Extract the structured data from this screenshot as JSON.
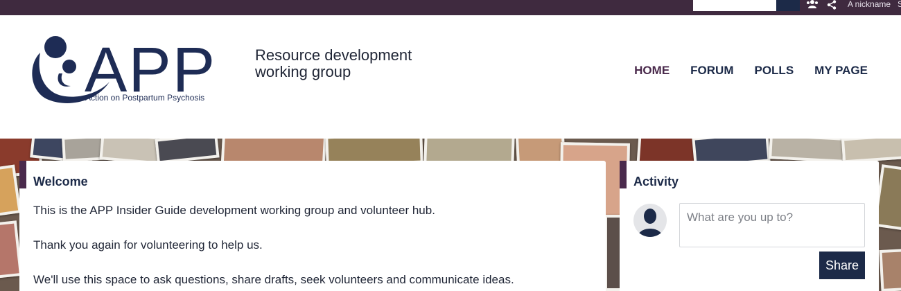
{
  "topbar": {
    "nickname": "A nickname",
    "cut_text": "S",
    "icons": {
      "people": "people-icon",
      "share": "share-icon"
    }
  },
  "header": {
    "logo_text": "APP",
    "logo_subtitle": "Action on Postpartum Psychosis",
    "group_title_line1": "Resource development",
    "group_title_line2": "working group",
    "nav": [
      {
        "label": "HOME",
        "active": true
      },
      {
        "label": "FORUM",
        "active": false
      },
      {
        "label": "POLLS",
        "active": false
      },
      {
        "label": "MY PAGE",
        "active": false
      }
    ]
  },
  "welcome": {
    "title": "Welcome",
    "paragraphs": [
      "This is the APP Insider Guide development working group and volunteer hub.",
      "Thank you again for volunteering to help us.",
      "We'll use this space to ask questions, share drafts, seek volunteers and communicate ideas."
    ]
  },
  "activity": {
    "title": "Activity",
    "placeholder": "What are you up to?",
    "share_label": "Share"
  },
  "colors": {
    "topbar": "#3f2a3f",
    "brand_navy": "#1c2a48",
    "accent_purple": "#4a2a4c"
  }
}
